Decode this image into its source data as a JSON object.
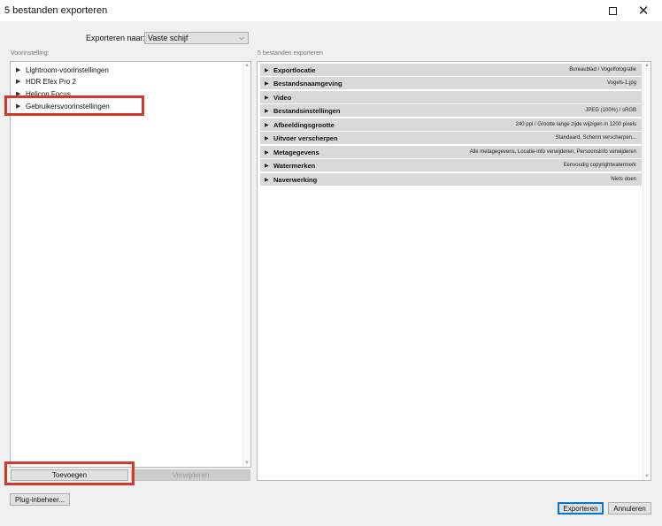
{
  "window": {
    "title": "5 bestanden exporteren",
    "maximize_icon": "maximize-icon",
    "close_symbol": "✕"
  },
  "export_to": {
    "label": "Exporteren naar:",
    "value": "Vaste schijf",
    "chevron": "⌵"
  },
  "presets": {
    "label": "Voorinstelling:",
    "items": [
      {
        "label": "Lightroom-voorinstellingen"
      },
      {
        "label": "HDR Efex Pro 2"
      },
      {
        "label": "Helicon Focus"
      },
      {
        "label": "Gebruikersvoorinstellingen"
      }
    ],
    "add_button": "Toevoegen",
    "remove_button": "Verwijderen"
  },
  "settings": {
    "label": "5 bestanden exporteren",
    "sections": [
      {
        "name": "Exportlocatie",
        "summary": "Bureaublad / Vogelfotografie"
      },
      {
        "name": "Bestandsnaamgeving",
        "summary": "Vogels-1.jpg"
      },
      {
        "name": "Video",
        "summary": ""
      },
      {
        "name": "Bestandsinstellingen",
        "summary": "JPEG (100%) / sRGB"
      },
      {
        "name": "Afbeeldingsgrootte",
        "summary": "240 ppi / Grootte lange zijde wijzigen in 1200 pixels"
      },
      {
        "name": "Uitvoer verscherpen",
        "summary": "Standaard, Scherm verscherpen..."
      },
      {
        "name": "Metagegevens",
        "summary": "Alle metagegevens, Locatie-info verwijderen, Persoonsinfo verwijderen"
      },
      {
        "name": "Watermerken",
        "summary": "Eenvoudig copyrightwatermerk"
      },
      {
        "name": "Naverwerking",
        "summary": "Niets doen"
      }
    ]
  },
  "footer": {
    "plugin_button": "Plug-inbeheer...",
    "export_button": "Exporteren",
    "cancel_button": "Annuleren"
  },
  "colors": {
    "highlight": "#d03a2a",
    "primary_border": "#0078d7"
  }
}
